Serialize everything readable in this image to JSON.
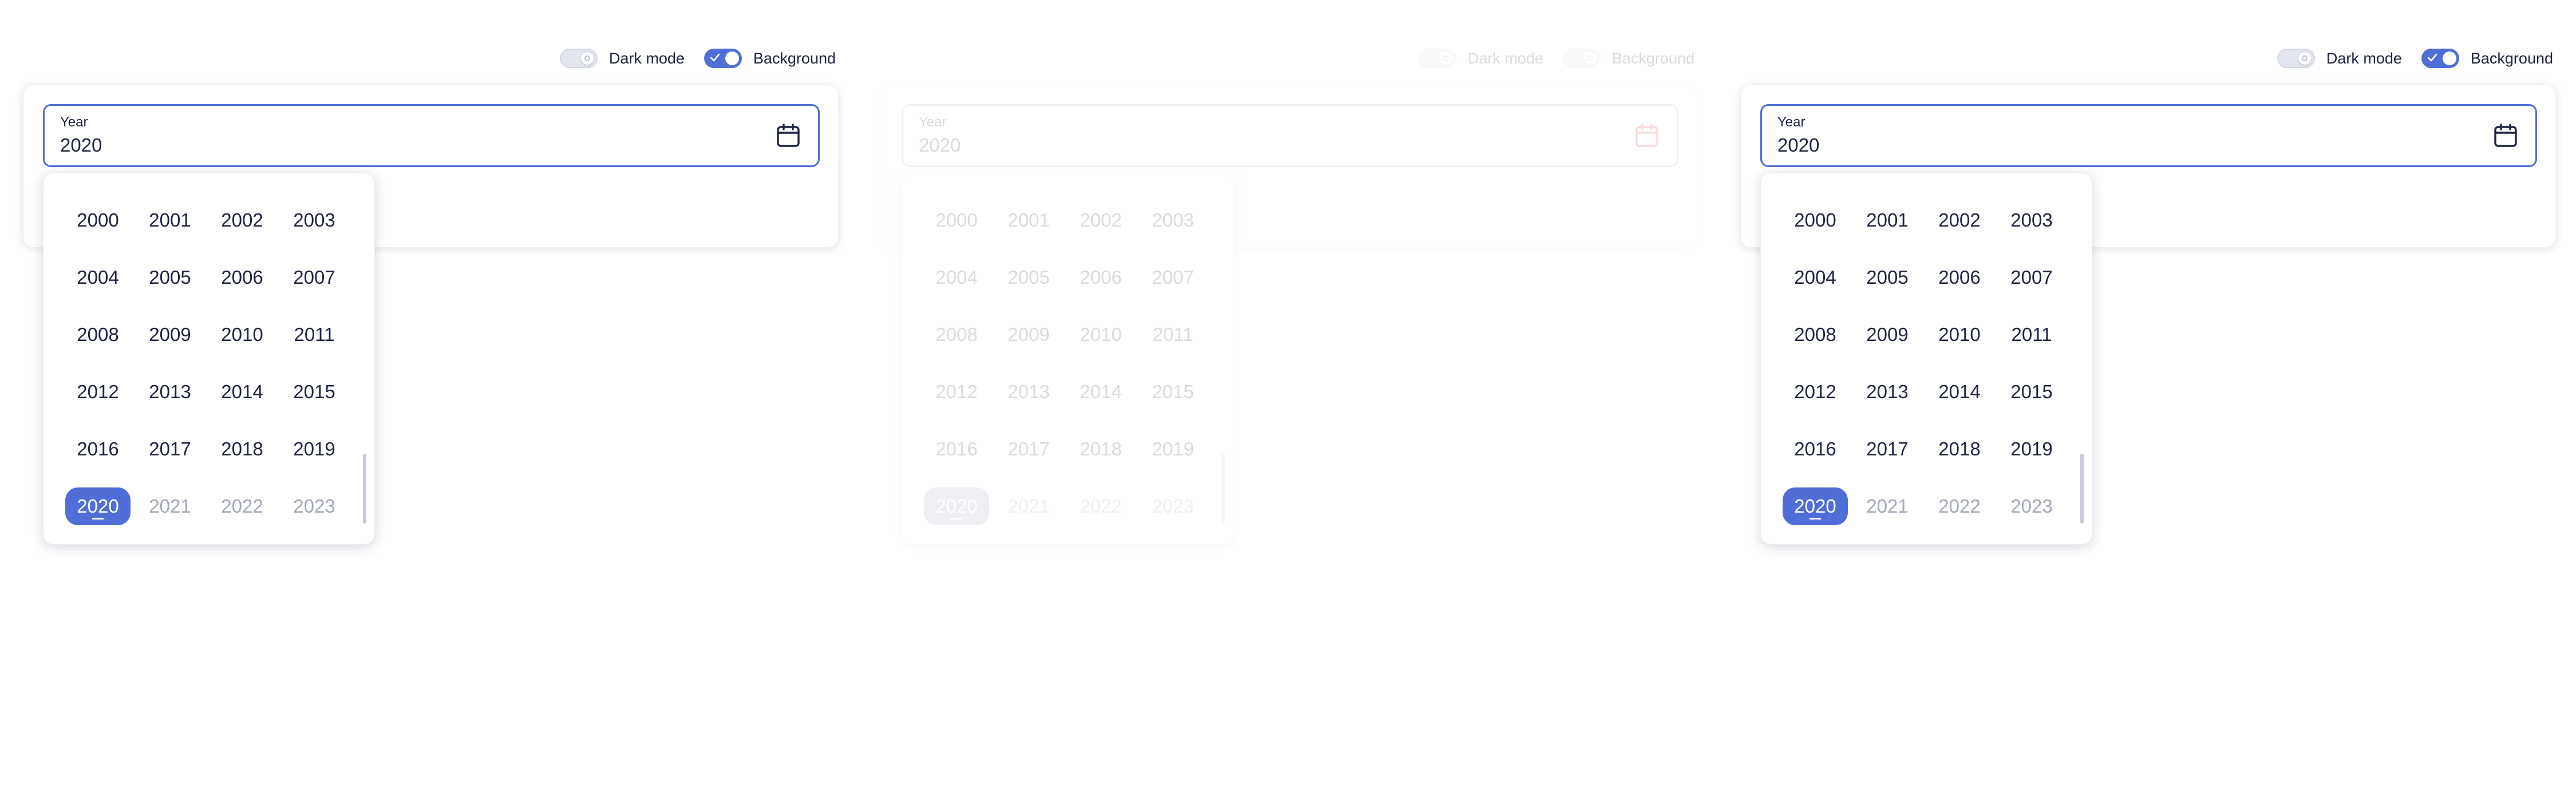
{
  "panels": [
    {
      "toggles": [
        {
          "label": "Dark mode",
          "state": "off"
        },
        {
          "label": "Background",
          "state": "on"
        }
      ],
      "field": {
        "label": "Year",
        "value": "2020"
      },
      "calendar_icon_color": "#1e2340",
      "years": [
        "2000",
        "2001",
        "2002",
        "2003",
        "2004",
        "2005",
        "2006",
        "2007",
        "2008",
        "2009",
        "2010",
        "2011",
        "2012",
        "2013",
        "2014",
        "2015",
        "2016",
        "2017",
        "2018",
        "2019",
        "2020",
        "2021",
        "2022",
        "2023"
      ],
      "selected_year": "2020",
      "muted_years": [
        "2021",
        "2022",
        "2023"
      ]
    },
    {
      "toggles": [
        {
          "label": "Dark mode",
          "state": "off"
        },
        {
          "label": "Background",
          "state": "off"
        }
      ],
      "field": {
        "label": "Year",
        "value": "2020"
      },
      "calendar_icon_color": "#e02424",
      "years": [
        "2000",
        "2001",
        "2002",
        "2003",
        "2004",
        "2005",
        "2006",
        "2007",
        "2008",
        "2009",
        "2010",
        "2011",
        "2012",
        "2013",
        "2014",
        "2015",
        "2016",
        "2017",
        "2018",
        "2019",
        "2020",
        "2021",
        "2022",
        "2023"
      ],
      "selected_year": "2020",
      "muted_years": [
        "2021",
        "2022",
        "2023"
      ]
    },
    {
      "toggles": [
        {
          "label": "Dark mode",
          "state": "off"
        },
        {
          "label": "Background",
          "state": "on"
        }
      ],
      "field": {
        "label": "Year",
        "value": "2020"
      },
      "calendar_icon_color": "#1e2340",
      "years": [
        "2000",
        "2001",
        "2002",
        "2003",
        "2004",
        "2005",
        "2006",
        "2007",
        "2008",
        "2009",
        "2010",
        "2011",
        "2012",
        "2013",
        "2014",
        "2015",
        "2016",
        "2017",
        "2018",
        "2019",
        "2020",
        "2021",
        "2022",
        "2023"
      ],
      "selected_year": "2020",
      "muted_years": [
        "2021",
        "2022",
        "2023"
      ]
    }
  ],
  "colors": {
    "accent": "#4f6ed8",
    "text": "#1e2340",
    "muted_text": "#a2a7b8"
  }
}
